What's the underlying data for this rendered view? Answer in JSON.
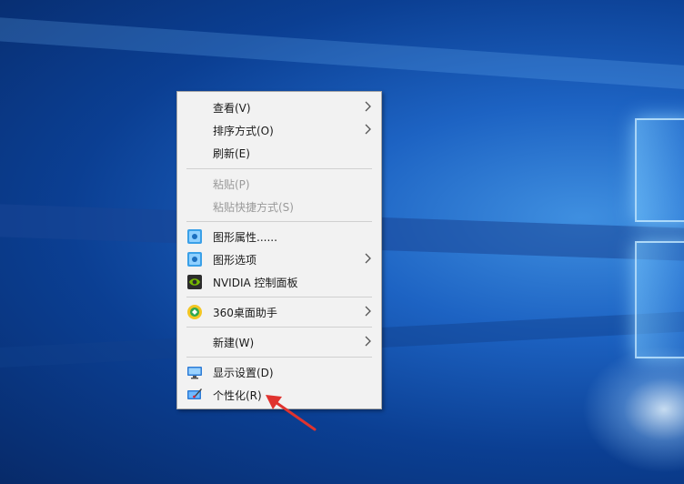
{
  "menu": {
    "items": [
      {
        "label": "查看(V)",
        "submenu": true,
        "disabled": false,
        "icon": null
      },
      {
        "label": "排序方式(O)",
        "submenu": true,
        "disabled": false,
        "icon": null
      },
      {
        "label": "刷新(E)",
        "submenu": false,
        "disabled": false,
        "icon": null
      },
      {
        "label": "粘贴(P)",
        "submenu": false,
        "disabled": true,
        "icon": null
      },
      {
        "label": "粘贴快捷方式(S)",
        "submenu": false,
        "disabled": true,
        "icon": null
      },
      {
        "label": "图形属性......",
        "submenu": false,
        "disabled": false,
        "icon": "intel-graphics-icon"
      },
      {
        "label": "图形选项",
        "submenu": true,
        "disabled": false,
        "icon": "intel-graphics-icon"
      },
      {
        "label": "NVIDIA 控制面板",
        "submenu": false,
        "disabled": false,
        "icon": "nvidia-icon"
      },
      {
        "label": "360桌面助手",
        "submenu": true,
        "disabled": false,
        "icon": "360-icon"
      },
      {
        "label": "新建(W)",
        "submenu": true,
        "disabled": false,
        "icon": null
      },
      {
        "label": "显示设置(D)",
        "submenu": false,
        "disabled": false,
        "icon": "display-icon"
      },
      {
        "label": "个性化(R)",
        "submenu": false,
        "disabled": false,
        "icon": "personalize-icon"
      }
    ]
  },
  "colors": {
    "menu_bg": "#f2f2f2",
    "menu_border": "#a6a6a6",
    "disabled_text": "#9a9a9a",
    "annotation_arrow": "#e0332f"
  }
}
